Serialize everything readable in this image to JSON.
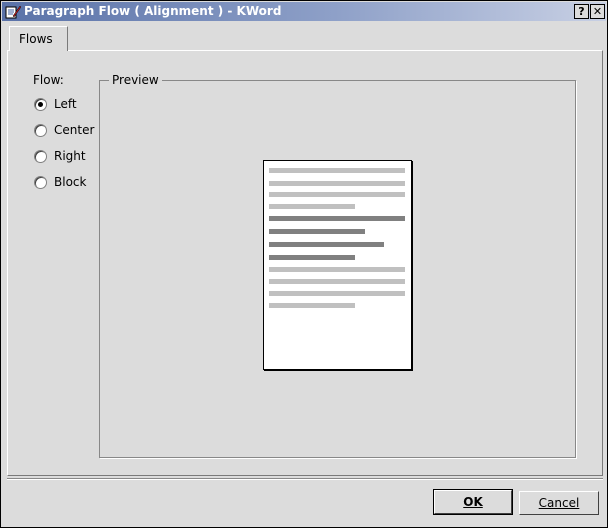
{
  "window": {
    "title": "Paragraph Flow ( Alignment ) - KWord",
    "help_button": "?",
    "close_button": "✕"
  },
  "tabs": [
    {
      "label": "Flows",
      "active": true
    }
  ],
  "flow": {
    "label": "Flow:",
    "options": [
      {
        "label": "Left",
        "selected": true
      },
      {
        "label": "Center",
        "selected": false
      },
      {
        "label": "Right",
        "selected": false
      },
      {
        "label": "Block",
        "selected": false
      }
    ]
  },
  "preview": {
    "label": "Preview"
  },
  "buttons": {
    "ok": "OK",
    "cancel": "Cancel"
  },
  "colors": {
    "titlebar_start": "#5a72a8",
    "titlebar_end": "#c8d0e4",
    "dialog_bg": "#dcdcdc"
  }
}
